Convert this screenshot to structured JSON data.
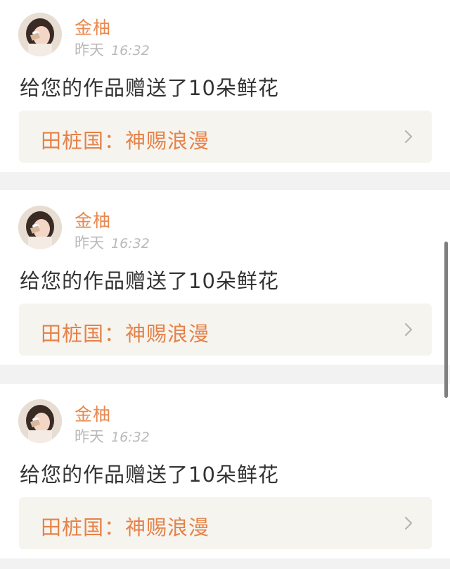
{
  "notifications": [
    {
      "username": "金柚",
      "day": "昨天",
      "time": "16:32",
      "message": "给您的作品赠送了10朵鲜花",
      "work_title": "田桩国：神赐浪漫"
    },
    {
      "username": "金柚",
      "day": "昨天",
      "time": "16:32",
      "message": "给您的作品赠送了10朵鲜花",
      "work_title": "田桩国：神赐浪漫"
    },
    {
      "username": "金柚",
      "day": "昨天",
      "time": "16:32",
      "message": "给您的作品赠送了10朵鲜花",
      "work_title": "田桩国：神赐浪漫"
    }
  ],
  "icons": {
    "avatar": "user-avatar",
    "chevron": "chevron-right-icon"
  },
  "colors": {
    "accent": "#e9894f",
    "link_bg": "#f6f4ef",
    "text": "#333333",
    "muted": "#b9b9b9",
    "page_bg": "#f2f2f2"
  }
}
